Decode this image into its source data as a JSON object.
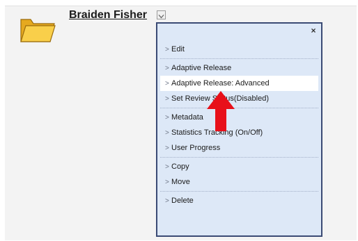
{
  "item": {
    "title": "Braiden Fisher"
  },
  "icons": {
    "folder": "folder-icon",
    "menu_trigger": "chevron-down-icon",
    "close": "close-icon",
    "chevron": "chevron-right-icon",
    "annotation": "red-arrow"
  },
  "menu": {
    "close_label": "×",
    "chevron": ">",
    "groups": [
      {
        "items": [
          {
            "label": "Edit"
          }
        ]
      },
      {
        "items": [
          {
            "label": "Adaptive Release"
          },
          {
            "label": "Adaptive Release: Advanced",
            "highlighted": true
          },
          {
            "label": "Set Review Status(Disabled)"
          }
        ]
      },
      {
        "items": [
          {
            "label": "Metadata"
          },
          {
            "label": "Statistics Tracking (On/Off)"
          },
          {
            "label": "User Progress"
          }
        ]
      },
      {
        "items": [
          {
            "label": "Copy"
          },
          {
            "label": "Move"
          }
        ]
      },
      {
        "items": [
          {
            "label": "Delete"
          }
        ]
      }
    ]
  },
  "colors": {
    "menu_background": "#dde8f7",
    "menu_border": "#3a4a74",
    "highlight": "#ffffff",
    "arrow": "#e8101a",
    "folder_fill": "#f6c53a"
  }
}
